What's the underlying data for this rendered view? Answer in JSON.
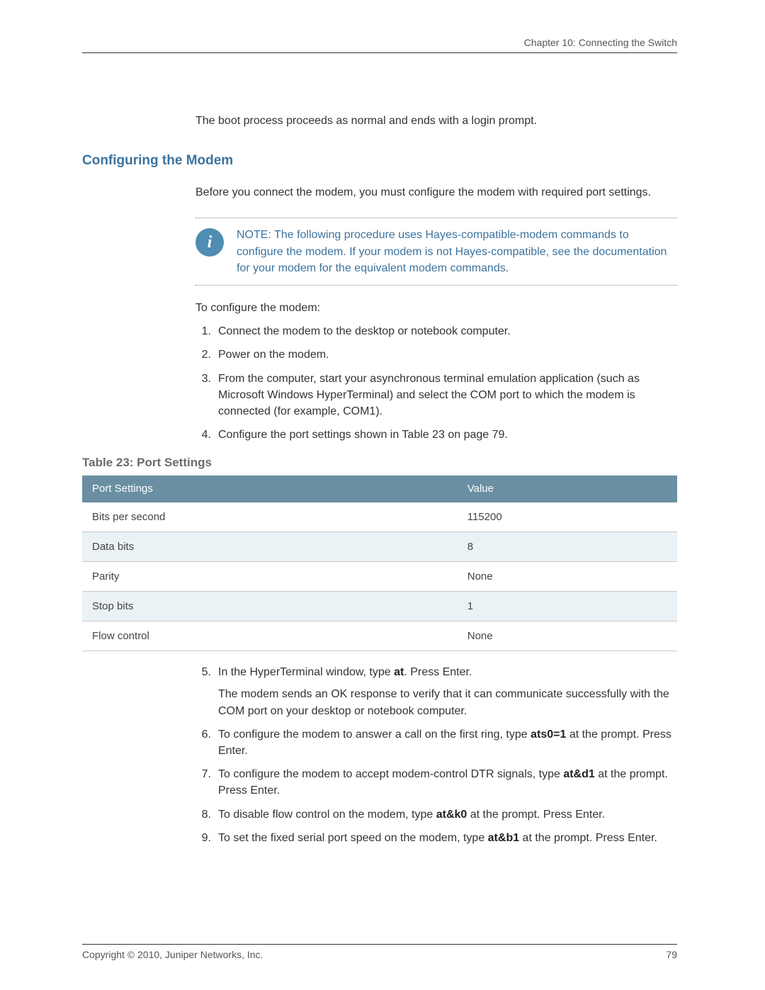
{
  "header": {
    "chapter_label": "Chapter 10: Connecting the Switch"
  },
  "intro_line": "The boot process proceeds as normal and ends with a login prompt.",
  "section_title": "Configuring the Modem",
  "lead_in": "Before you connect the modem, you must configure the modem with required port settings.",
  "note": {
    "prefix": "NOTE:",
    "text": " The following procedure uses Hayes-compatible-modem commands to configure the modem. If your modem is not Hayes-compatible, see the documentation for your modem for the equivalent modem commands."
  },
  "to_configure": "To configure the modem:",
  "steps_a": [
    {
      "n": "1.",
      "t": "Connect the modem to the desktop or notebook computer."
    },
    {
      "n": "2.",
      "t": "Power on the modem."
    },
    {
      "n": "3.",
      "t": "From the computer, start your asynchronous terminal emulation application (such as Microsoft Windows HyperTerminal) and select the COM port to which the modem is connected (for example, COM1)."
    },
    {
      "n": "4.",
      "t": "Configure the port settings shown in Table 23 on page 79."
    }
  ],
  "table": {
    "caption": "Table 23: Port Settings",
    "head": {
      "c1": "Port Settings",
      "c2": "Value"
    },
    "rows": [
      {
        "c1": "Bits per second",
        "c2": "115200"
      },
      {
        "c1": "Data bits",
        "c2": "8"
      },
      {
        "c1": "Parity",
        "c2": "None"
      },
      {
        "c1": "Stop bits",
        "c2": "1"
      },
      {
        "c1": "Flow control",
        "c2": "None"
      }
    ]
  },
  "steps_b": [
    {
      "n": "5.",
      "pre": "In the HyperTerminal window, type ",
      "bold": "at",
      "post": ". Press Enter.",
      "follow": "The modem sends an OK response to verify that it can communicate successfully with the COM port on your desktop or notebook computer."
    },
    {
      "n": "6.",
      "pre": "To configure the modem to answer a call on the first ring, type ",
      "bold": "ats0=1",
      "post": " at the prompt. Press Enter."
    },
    {
      "n": "7.",
      "pre": "To configure the modem to accept modem-control DTR signals, type ",
      "bold": "at&d1",
      "post": " at the prompt. Press Enter."
    },
    {
      "n": "8.",
      "pre": "To disable flow control on the modem, type ",
      "bold": "at&k0",
      "post": " at the prompt. Press Enter."
    },
    {
      "n": "9.",
      "pre": "To set the fixed serial port speed on the modem, type ",
      "bold": "at&b1",
      "post": " at the prompt. Press Enter."
    }
  ],
  "footer": {
    "copyright": "Copyright © 2010, Juniper Networks, Inc.",
    "page": "79"
  }
}
